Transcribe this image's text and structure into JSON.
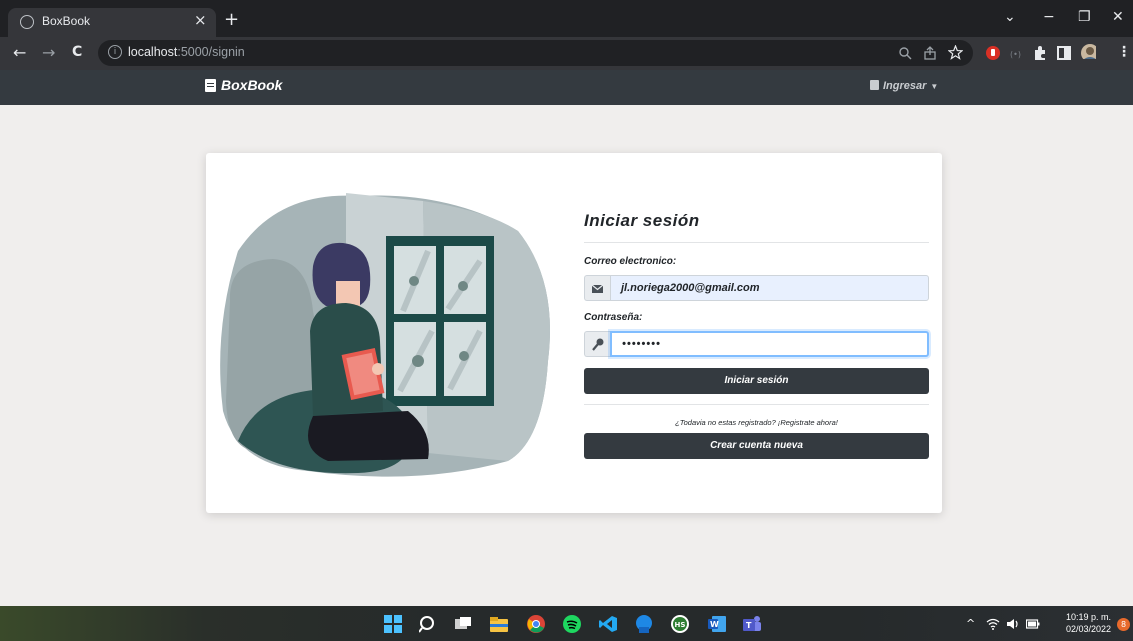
{
  "browser": {
    "tab_title": "BoxBook",
    "tab_close": "×",
    "new_tab": "+",
    "url_host": "localhost",
    "url_path": ":5000/signin",
    "back": "←",
    "forward": "→",
    "reload": "C",
    "info": "i",
    "minimize": "−",
    "maximize": "❐",
    "close": "✕",
    "dropdown": "⌄"
  },
  "navbar": {
    "brand": "BoxBook",
    "login_menu": "Ingresar"
  },
  "form": {
    "title": "Iniciar sesión",
    "email_label": "Correo electronico:",
    "email_value": "jl.noriega2000@gmail.com",
    "password_label": "Contraseña:",
    "password_value": "••••••••",
    "login_button": "Iniciar sesión",
    "register_prompt": "¿Todavia no estas registrado? ¡Registrate ahora!",
    "create_button": "Crear cuenta nueva"
  },
  "taskbar": {
    "time": "10:19 p. m.",
    "date": "02/03/2022",
    "notifications": "8"
  },
  "colors": {
    "navbar": "#343a40",
    "card": "#ffffff",
    "page_bg": "#f0eeed",
    "email_fill": "#e8f0fe",
    "focus_ring": "#80bdff"
  }
}
